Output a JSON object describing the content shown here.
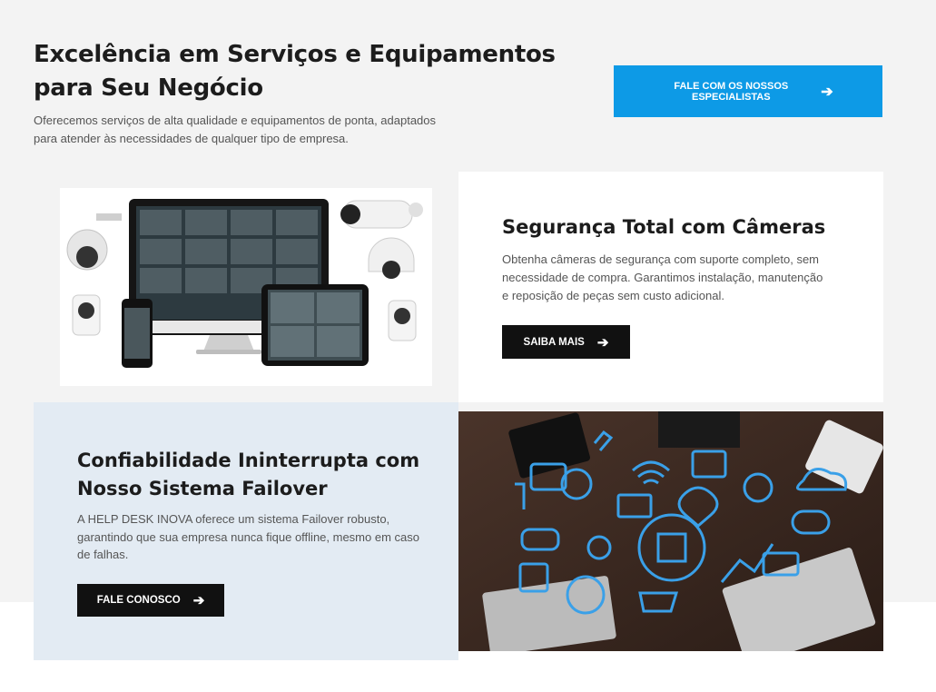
{
  "hero": {
    "title": "Excelência em Serviços e Equipamentos para Seu Negócio",
    "subtitle": "Oferecemos serviços de alta qualidade e equipamentos de ponta, adaptados para atender às necessidades de qualquer tipo de empresa.",
    "cta_label": "FALE COM OS NOSSOS ESPECIALISTAS",
    "cta_icon": "arrow-right-icon",
    "cta_color": "#0d9ae6"
  },
  "security": {
    "title": "Segurança Total com Câmeras",
    "body": "Obtenha câmeras de segurança com suporte completo, sem necessidade de compra. Garantimos instalação, manutenção e reposição de peças sem custo adicional.",
    "button_label": "SAIBA MAIS",
    "button_icon": "arrow-right-icon"
  },
  "failover": {
    "title": "Confiabilidade Ininterrupta com Nosso Sistema Failover",
    "body": "A HELP DESK INOVA oferece um sistema Failover robusto, garantindo que sua empresa nunca fique offline, mesmo em caso de falhas.",
    "button_label": "FALE CONOSCO",
    "button_icon": "arrow-right-icon",
    "card_color": "#e3ebf3"
  }
}
